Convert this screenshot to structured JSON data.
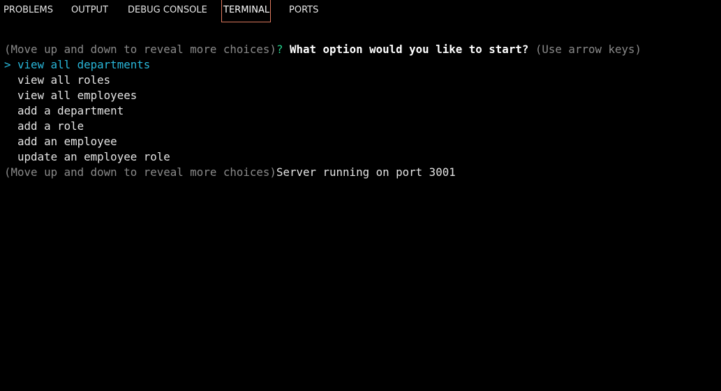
{
  "panel": {
    "tabs": [
      {
        "label": "PROBLEMS"
      },
      {
        "label": "OUTPUT"
      },
      {
        "label": "DEBUG CONSOLE"
      },
      {
        "label": "TERMINAL"
      },
      {
        "label": "PORTS"
      }
    ],
    "active_tab": "TERMINAL",
    "active_border_color": "#e07a5f"
  },
  "terminal": {
    "hint": "(Move up and down to reveal more choices)",
    "prompt_mark": "?",
    "question": "What option would you like to start?",
    "instruction": "(Use arrow keys)",
    "pointer": ">",
    "choices": [
      "view all departments",
      "view all roles",
      "view all employees",
      "add a department",
      "add a role",
      "add an employee",
      "update an employee role"
    ],
    "selected_index": 0,
    "footer_hint": "(Move up and down to reveal more choices)",
    "server_message": "Server running on port 3001",
    "colors": {
      "background": "#000000",
      "text": "#e5e5e5",
      "dim": "#8a8a8a",
      "prompt_mark": "#23d18b",
      "selected": "#29b8db"
    }
  }
}
